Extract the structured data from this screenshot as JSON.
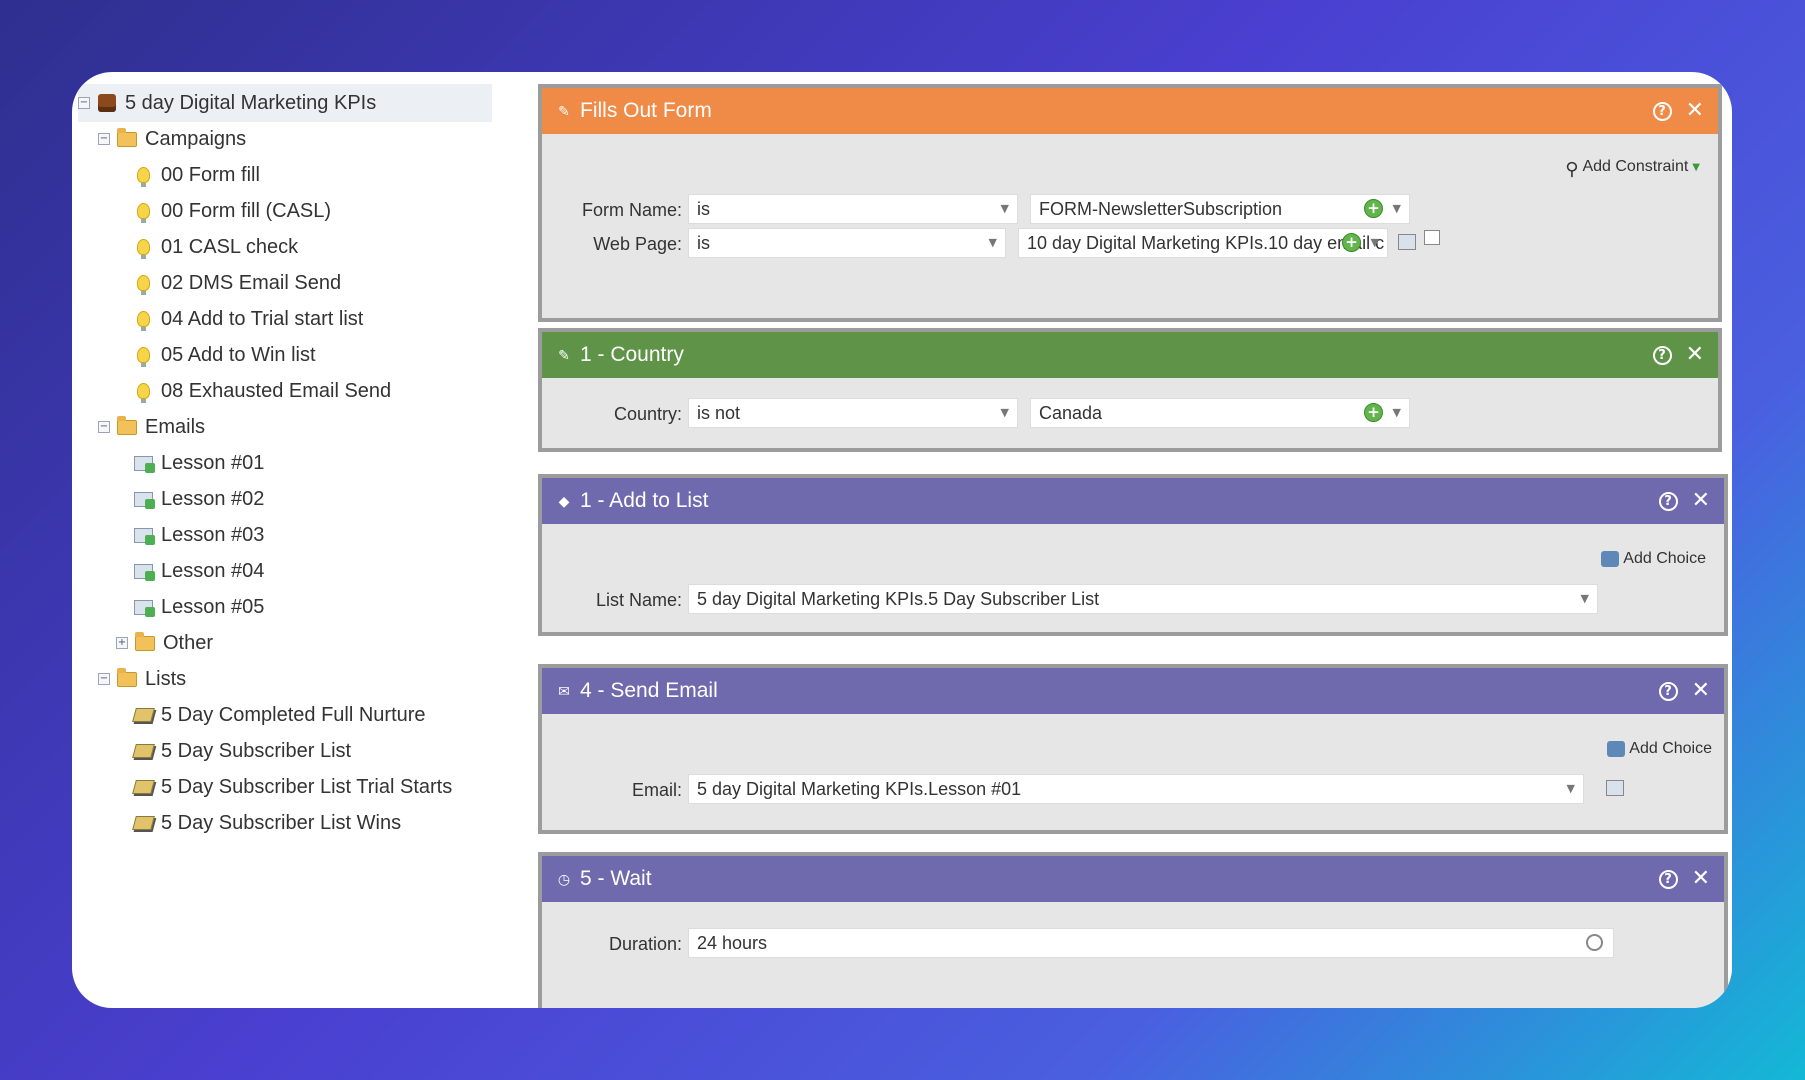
{
  "sidebar": {
    "root": {
      "label": "5 day Digital Marketing KPIs",
      "icon": "program-icon"
    },
    "campaigns": {
      "label": "Campaigns",
      "items": [
        "00 Form fill",
        "00 Form fill (CASL)",
        "01 CASL check",
        "02 DMS Email Send",
        "04 Add to Trial start list",
        "05 Add to Win list",
        "08 Exhausted Email Send"
      ]
    },
    "emails": {
      "label": "Emails",
      "items": [
        "Lesson #01",
        "Lesson #02",
        "Lesson #03",
        "Lesson #04",
        "Lesson #05"
      ]
    },
    "other": {
      "label": "Other"
    },
    "lists": {
      "label": "Lists",
      "items": [
        "5 Day Completed Full Nurture",
        "5 Day Subscriber List",
        "5 Day Subscriber List Trial Starts",
        "5 Day Subscriber List Wins"
      ]
    }
  },
  "panels": {
    "fills_out_form": {
      "title": "Fills Out Form",
      "color": "#ef8a47",
      "add_constraint": "Add Constraint",
      "form_name_label": "Form Name:",
      "form_name_operator": "is",
      "form_name_value": "FORM-NewsletterSubscription",
      "web_page_label": "Web Page:",
      "web_page_operator": "is",
      "web_page_value": "10 day Digital Marketing KPIs.10 day email c"
    },
    "country": {
      "title": "1 - Country",
      "color": "#5f9448",
      "country_label": "Country:",
      "country_operator": "is not",
      "country_value": "Canada"
    },
    "add_to_list": {
      "title": "1 - Add to List",
      "color": "#6f6aae",
      "add_choice": "Add Choice",
      "list_name_label": "List Name:",
      "list_name_value": "5 day Digital Marketing KPIs.5 Day Subscriber List"
    },
    "send_email": {
      "title": "4 - Send Email",
      "color": "#6f6aae",
      "add_choice": "Add Choice",
      "email_label": "Email:",
      "email_value": "5 day Digital Marketing KPIs.Lesson #01"
    },
    "wait": {
      "title": "5 - Wait",
      "color": "#6f6aae",
      "duration_label": "Duration:",
      "duration_value": "24 hours"
    }
  },
  "glyphs": {
    "help": "?",
    "close": "✕",
    "caret": "▼",
    "plus": "+",
    "expand": "−",
    "collapsed": "+"
  }
}
